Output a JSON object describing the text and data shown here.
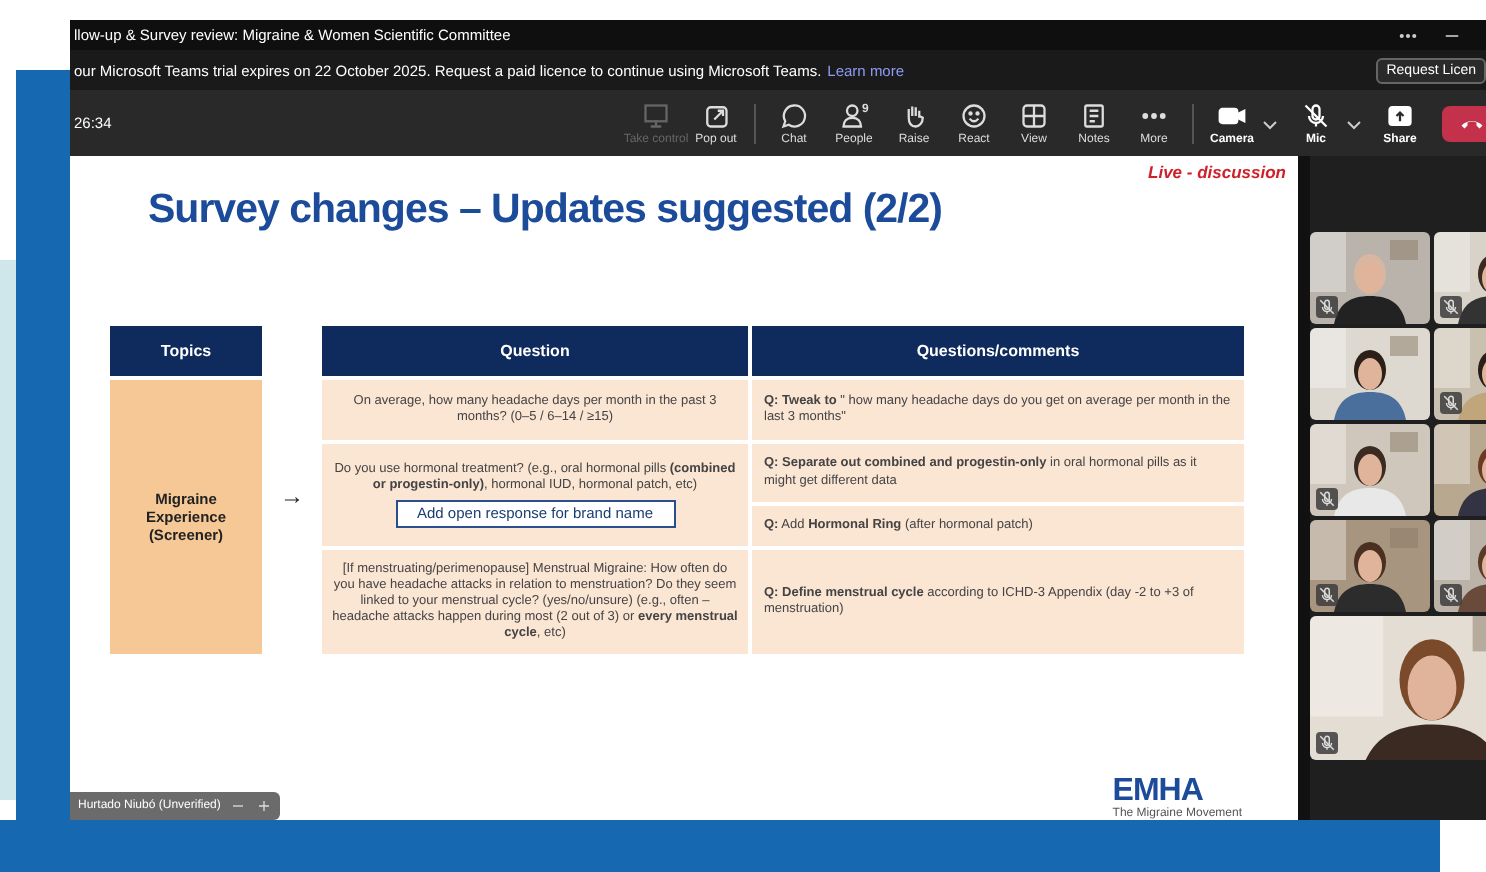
{
  "window": {
    "title": "llow-up & Survey review: Migraine & Women Scientific Committee"
  },
  "banner": {
    "text": "our Microsoft Teams trial expires on 22 October 2025. Request a paid licence to continue using Microsoft Teams.",
    "link": "Learn more",
    "button": "Request Licen"
  },
  "toolbar": {
    "timer": "26:34",
    "buttons": [
      {
        "label": "Take control",
        "kind": "plain",
        "disabled": true
      },
      {
        "label": "Pop out",
        "kind": "plain",
        "disabled": false
      },
      {
        "label": "Chat",
        "kind": "plain",
        "disabled": false
      },
      {
        "label": "People",
        "kind": "plain",
        "disabled": false,
        "badge": "9"
      },
      {
        "label": "Raise",
        "kind": "plain",
        "disabled": false
      },
      {
        "label": "React",
        "kind": "plain",
        "disabled": false
      },
      {
        "label": "View",
        "kind": "plain",
        "disabled": false
      },
      {
        "label": "Notes",
        "kind": "plain",
        "disabled": false
      },
      {
        "label": "More",
        "kind": "plain",
        "disabled": false
      },
      {
        "label": "Camera",
        "kind": "split",
        "disabled": false
      },
      {
        "label": "Mic",
        "kind": "split",
        "disabled": false
      },
      {
        "label": "Share",
        "kind": "plain",
        "disabled": false
      }
    ]
  },
  "slide": {
    "live_label": "Live - discussion",
    "title": "Survey changes – Updates suggested (2/2)",
    "columns": [
      "Topics",
      "Question",
      "Questions/comments"
    ],
    "topic": "Migraine Experience (Screener)",
    "arrow": "→",
    "rows": [
      {
        "question": "On average, how many headache days per month in the past 3 months? (0–5 / 6–14 / ≥15)",
        "comments": [
          "**Q: Tweak to** \" how many headache days do you get on average per month in the last 3 months\""
        ]
      },
      {
        "question": "Do you use hormonal treatment? (e.g., oral hormonal pills **(combined or progestin-only)**, hormonal IUD, hormonal patch, etc)",
        "note": "Add open response for brand name",
        "comments": [
          "**Q: Separate out combined and progestin-only** in oral hormonal pills as it might get different data",
          "**Q:** Add **Hormonal Ring** (after hormonal patch)"
        ]
      },
      {
        "question": "[If menstruating/perimenopause] Menstrual Migraine: How often do you have headache attacks in relation to menstruation? Do they seem linked to your menstrual cycle? (yes/no/unsure) (e.g., often – headache attacks happen during most (2 out of 3) or **every menstrual cycle**, etc)",
        "comments": [
          "**Q: Define menstrual cycle** according to ICHD-3 Appendix (day -2 to +3 of menstruation)"
        ]
      }
    ],
    "logo": {
      "mark": "EMHA",
      "tagline": "The Migraine Movement"
    },
    "name_tag": "Hurtado Niubó (Unverified)"
  },
  "participants": [
    {
      "muted": true
    },
    {
      "muted": true
    },
    {
      "muted": false
    },
    {
      "muted": true
    },
    {
      "muted": true
    },
    {
      "muted": false
    },
    {
      "muted": true
    },
    {
      "muted": true
    },
    {
      "muted": true
    }
  ]
}
